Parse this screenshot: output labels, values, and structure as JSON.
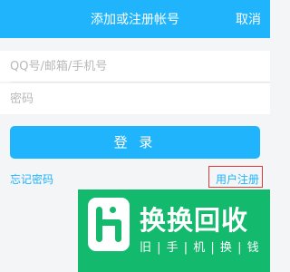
{
  "header": {
    "title": "添加或注册帐号",
    "cancel_label": "取消"
  },
  "form": {
    "account_placeholder": "QQ号/邮箱/手机号",
    "password_placeholder": "密码",
    "login_label": "登 录",
    "forgot_label": "忘记密码",
    "register_label": "用户注册"
  },
  "banner": {
    "title": "换换回收",
    "subtitle": "旧 | 手 | 机 | 换 | 钱",
    "logo_icon": "h-logo-icon"
  },
  "colors": {
    "accent": "#1fb4fb",
    "banner": "#13b96c",
    "highlight": "#e03a3a"
  }
}
